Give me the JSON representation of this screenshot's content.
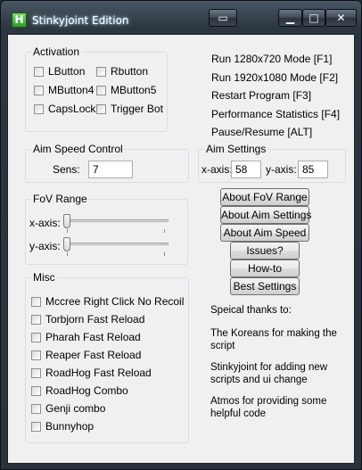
{
  "window": {
    "title": "Stinkyjoint Edition",
    "app_icon_letter": "H"
  },
  "titlebar_buttons": [
    {
      "name": "extra",
      "glyph": "▭"
    },
    {
      "name": "minimize",
      "glyph": "▁"
    },
    {
      "name": "maximize",
      "glyph": "□"
    },
    {
      "name": "close",
      "glyph": "✕"
    }
  ],
  "activation": {
    "title": "Activation",
    "options": [
      "LButton",
      "Rbutton",
      "MButton4",
      "MButton5",
      "CapsLock",
      "Trigger Bot"
    ]
  },
  "hotkeys": [
    "Run 1280x720 Mode [F1]",
    "Run 1920x1080 Mode [F2]",
    "Restart Program [F3]",
    "Performance Statistics [F4]",
    "Pause/Resume [ALT]"
  ],
  "aim_speed": {
    "title": "Aim Speed Control",
    "label": "Sens:",
    "value": "7"
  },
  "aim_settings": {
    "title": "Aim Settings",
    "x_label": "x-axis:",
    "x_value": "58",
    "y_label": "y-axis:",
    "y_value": "85"
  },
  "fov": {
    "title": "FoV Range",
    "x_label": "x-axis:",
    "y_label": "y-axis:",
    "x_level": 0.0,
    "y_level": 0.0
  },
  "buttons": [
    "About FoV Range",
    "About Aim Settings",
    "About Aim Speed",
    "Issues?",
    "How-to",
    "Best Settings"
  ],
  "misc": {
    "title": "Misc",
    "options": [
      "Mccree Right Click No Recoil",
      "Torbjorn Fast Reload",
      "Pharah Fast Reload",
      "Reaper Fast Reload",
      "RoadHog Fast Reload",
      "RoadHog Combo",
      "Genji combo",
      "Bunnyhop"
    ]
  },
  "credits": {
    "heading": "Speical thanks to:",
    "lines": [
      "The Koreans for making the script",
      "Stinkyjoint for adding new scripts and ui change",
      "Atmos for providing some helpful code"
    ]
  }
}
